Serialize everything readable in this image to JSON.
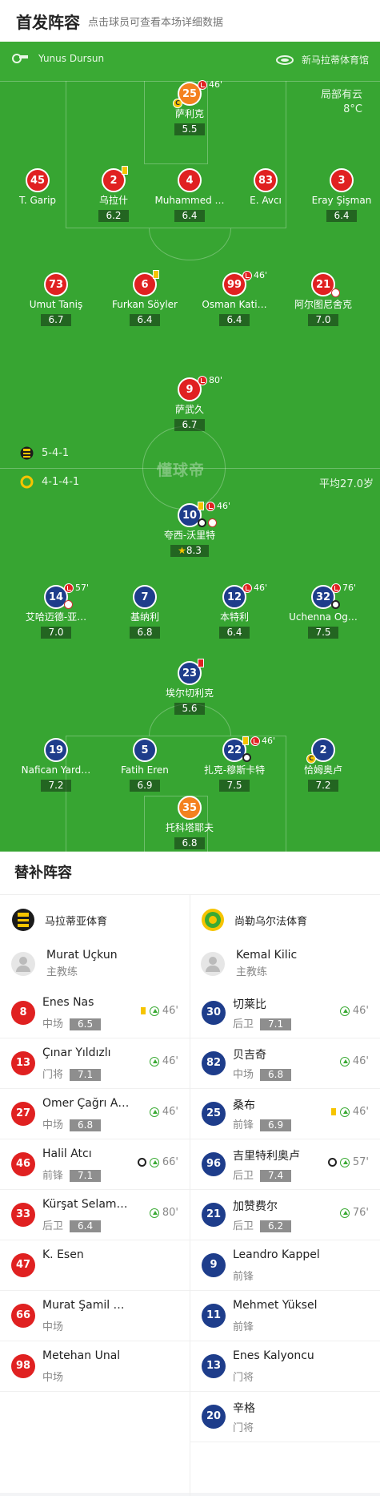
{
  "header": {
    "title": "首发阵容",
    "subtitle": "点击球员可查看本场详细数据"
  },
  "pitch_info": {
    "referee": "Yunus Dursun",
    "venue": "新马拉蒂体育馆",
    "weather": "局部有云",
    "temperature": "8°C",
    "watermark": "懂球帝"
  },
  "home_formation": "5-4-1",
  "away_formation": "4-1-4-1",
  "away_avg_age": "平均27.0岁",
  "colors": {
    "home": "#e02121",
    "away": "#1e3d8b",
    "gk": "#f4811f",
    "pitch": "#37a532"
  },
  "home_players": [
    {
      "num": "25",
      "name": "萨利克",
      "rating": "5.5",
      "sub_min": "46'",
      "captain": "C"
    },
    {
      "num": "45",
      "name": "T. Garip",
      "rating": ""
    },
    {
      "num": "2",
      "name": "乌拉什",
      "rating": "6.2",
      "card": "yellow"
    },
    {
      "num": "4",
      "name": "Muhammed …",
      "rating": "6.4"
    },
    {
      "num": "83",
      "name": "E. Avcı",
      "rating": ""
    },
    {
      "num": "3",
      "name": "Eray Şişman",
      "rating": "6.4"
    },
    {
      "num": "73",
      "name": "Umut Taniş",
      "rating": "6.7"
    },
    {
      "num": "6",
      "name": "Furkan Söyler",
      "rating": "6.4",
      "card": "yellow"
    },
    {
      "num": "99",
      "name": "Osman Kati…",
      "rating": "6.4",
      "sub_min": "46'"
    },
    {
      "num": "21",
      "name": "阿尔图尼舍克",
      "rating": "7.0"
    },
    {
      "num": "9",
      "name": "萨武久",
      "rating": "6.7",
      "sub_min": "80'"
    }
  ],
  "away_players": [
    {
      "num": "10",
      "name": "夸西-沃里特",
      "rating": "8.3",
      "sub_min": "46'",
      "star": "★"
    },
    {
      "num": "14",
      "name": "艾哈迈德-亚…",
      "rating": "7.0",
      "sub_min": "57'"
    },
    {
      "num": "7",
      "name": "基纳利",
      "rating": "6.8"
    },
    {
      "num": "12",
      "name": "本特利",
      "rating": "6.4",
      "sub_min": "46'"
    },
    {
      "num": "32",
      "name": "Uchenna Og…",
      "rating": "7.5",
      "sub_min": "76'"
    },
    {
      "num": "23",
      "name": "埃尔切利克",
      "rating": "5.6",
      "card": "red"
    },
    {
      "num": "19",
      "name": "Nafican Yard…",
      "rating": "7.2"
    },
    {
      "num": "5",
      "name": "Fatih Eren",
      "rating": "6.9"
    },
    {
      "num": "22",
      "name": "扎克-穆斯卡特",
      "rating": "7.5",
      "sub_min": "46'"
    },
    {
      "num": "2",
      "name": "恰姆奥卢",
      "rating": "7.2",
      "captain": "C"
    },
    {
      "num": "35",
      "name": "托科塔耶夫",
      "rating": "6.8"
    }
  ],
  "subs": {
    "title": "替补阵容",
    "home": {
      "team": "马拉蒂亚体育",
      "coach": {
        "name": "Murat Uçkun",
        "role": "主教练"
      },
      "players": [
        {
          "num": "8",
          "name": "Enes Nas",
          "pos": "中场",
          "rating": "6.5",
          "min": "46'",
          "yellow": true
        },
        {
          "num": "13",
          "name": "Çınar Yıldızlı",
          "pos": "门将",
          "rating": "7.1",
          "min": "46'"
        },
        {
          "num": "27",
          "name": "Ömer Çağrı A…",
          "pos": "中场",
          "rating": "6.8",
          "min": "46'"
        },
        {
          "num": "46",
          "name": "Halil Atcı",
          "pos": "前锋",
          "rating": "7.1",
          "min": "66'",
          "goal": true
        },
        {
          "num": "33",
          "name": "Kürşat Selam…",
          "pos": "后卫",
          "rating": "6.4",
          "min": "80'"
        },
        {
          "num": "47",
          "name": "K. Esen",
          "pos": "",
          "rating": ""
        },
        {
          "num": "66",
          "name": "Murat Şamil …",
          "pos": "中场",
          "rating": ""
        },
        {
          "num": "98",
          "name": "Metehan Ünal",
          "pos": "中场",
          "rating": ""
        }
      ]
    },
    "away": {
      "team": "尚勒乌尔法体育",
      "coach": {
        "name": "Kemal Kilic",
        "role": "主教练"
      },
      "players": [
        {
          "num": "30",
          "name": "切莱比",
          "pos": "后卫",
          "rating": "7.1",
          "min": "46'"
        },
        {
          "num": "82",
          "name": "贝吉奇",
          "pos": "中场",
          "rating": "6.8",
          "min": "46'"
        },
        {
          "num": "25",
          "name": "桑布",
          "pos": "前锋",
          "rating": "6.9",
          "min": "46'",
          "yellow": true
        },
        {
          "num": "96",
          "name": "吉里特利奥卢",
          "pos": "后卫",
          "rating": "7.4",
          "min": "57'",
          "goal": true
        },
        {
          "num": "21",
          "name": "加赞费尔",
          "pos": "后卫",
          "rating": "6.2",
          "min": "76'"
        },
        {
          "num": "9",
          "name": "Leandro Kappel",
          "pos": "前锋",
          "rating": ""
        },
        {
          "num": "11",
          "name": "Mehmet Yüksel",
          "pos": "前锋",
          "rating": ""
        },
        {
          "num": "13",
          "name": "Enes Kalyoncu",
          "pos": "门将",
          "rating": ""
        },
        {
          "num": "20",
          "name": "辛格",
          "pos": "门将",
          "rating": ""
        }
      ]
    }
  }
}
